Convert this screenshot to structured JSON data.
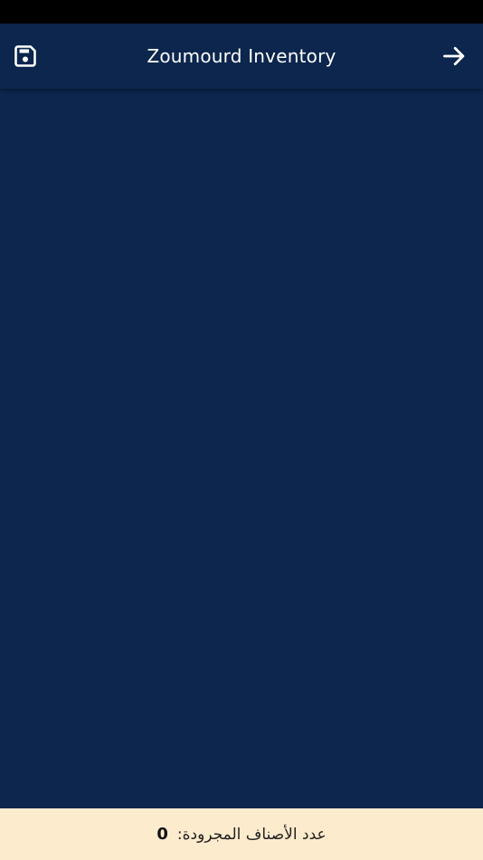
{
  "app": {
    "title": "Zoumourd Inventory",
    "colors": {
      "status_bar": "#000000",
      "primary": "#0c264d",
      "footer_background": "#fdebcd",
      "icon": "#ffffff"
    }
  },
  "toolbar": {
    "save_icon": "save-icon",
    "forward_icon": "arrow-forward-icon"
  },
  "footer": {
    "label": "عدد الأصناف المجرودة:",
    "count": "0"
  }
}
